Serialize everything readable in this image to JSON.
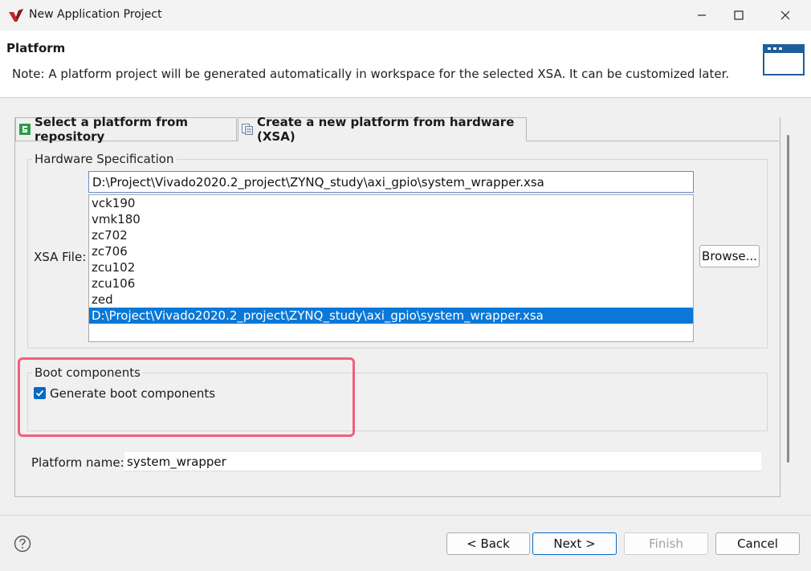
{
  "window": {
    "title": "New Application Project",
    "minimize_icon": "minimize-icon",
    "maximize_icon": "maximize-icon",
    "close_icon": "close-icon"
  },
  "header": {
    "title": "Platform",
    "note": "Note: A platform project will be generated automatically in workspace for the selected XSA. It can be customized later."
  },
  "tabs": [
    {
      "label": "Select a platform from repository",
      "icon": "repository-icon",
      "selected": false
    },
    {
      "label": "Create a new platform from hardware (XSA)",
      "icon": "hardware-icon",
      "selected": true
    }
  ],
  "hardware_spec": {
    "group_label": "Hardware Specification",
    "xsa_label": "XSA File:",
    "xsa_value": "D:\\Project\\Vivado2020.2_project\\ZYNQ_study\\axi_gpio\\system_wrapper.xsa",
    "list_items": [
      "vck190",
      "vmk180",
      "zc702",
      "zc706",
      "zcu102",
      "zcu106",
      "zed",
      "D:\\Project\\Vivado2020.2_project\\ZYNQ_study\\axi_gpio\\system_wrapper.xsa"
    ],
    "selected_index": 7,
    "browse_label": "Browse..."
  },
  "boot": {
    "group_label": "Boot components",
    "checkbox_label": "Generate boot components",
    "checked": true
  },
  "platform": {
    "label": "Platform name:",
    "value": "system_wrapper"
  },
  "footer": {
    "back_label": "< Back",
    "next_label": "Next >",
    "finish_label": "Finish",
    "cancel_label": "Cancel",
    "help_icon": "help-icon"
  },
  "colors": {
    "selection": "#0a78d7",
    "highlight_box": "#f0607a",
    "accent": "#0a67c2"
  }
}
